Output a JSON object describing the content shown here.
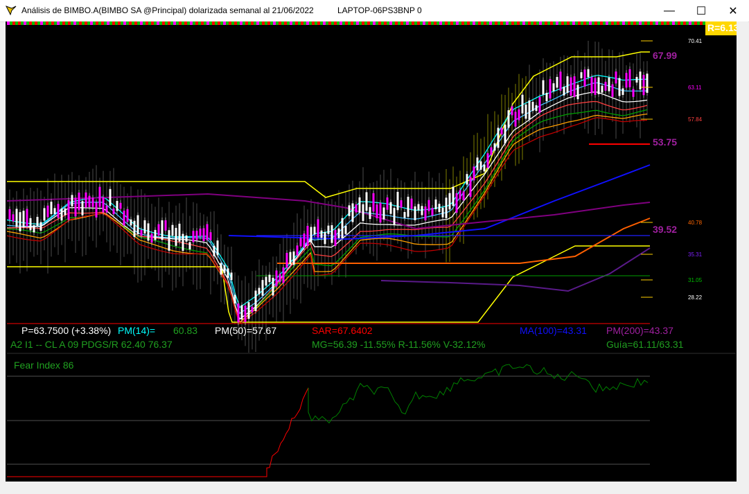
{
  "window": {
    "title": "Análisis de BIMBO.A(BIMBO SA @Principal) dolarizada semanal al 21/06/2022",
    "machine": "LAPTOP-06PS3BNP 0",
    "minimize_glyph": "—",
    "maximize_glyph": "☐",
    "close_glyph": "✕"
  },
  "colors": {
    "background": "#000000",
    "ichimoku": "#ffff00",
    "price_up": "#ffffff",
    "price_down": "#ff00ff",
    "sar": "#ff0000",
    "ma100": "#0000ff",
    "pm200": "#800080",
    "pm14": "#00ffff",
    "pm50": "#ffffff",
    "fear_green": "#008000",
    "fear_red": "#ff0000"
  },
  "r_badge": "R=6.13",
  "price_axis": {
    "top": "70.41",
    "l2": "63.11",
    "l3": "57.84",
    "l4": "40.78",
    "l5": "35.31",
    "l6": "31.05",
    "l7": "28.22",
    "big_top": "67.99",
    "big_mid": "53.75",
    "big_low": "39.52"
  },
  "info": {
    "p": "P=63.7500 (+3.38%)",
    "pm14_label": "PM(14)=",
    "pm14_value": "60.83",
    "pm50": "PM(50)=57.67",
    "sar": "SAR=67.6402",
    "ma100": "MA(100)=43.31",
    "pm200": "PM(200)=43.37",
    "line2_left": "A2 I1 -- CL A 09 PDGS/R 62.40 76.37",
    "line2_mid": "MG=56.39 -11.55% R-11.56% V-32.12%",
    "line2_right": "Guía=61.11/63.31"
  },
  "fear": {
    "label": "Fear Index 86"
  },
  "chart_data": {
    "type": "line",
    "title": "Análisis de BIMBO.A(BIMBO SA @Principal) dolarizada semanal al 21/06/2022",
    "y_ticks": [
      70.41,
      63.11,
      57.84,
      40.78,
      35.31,
      31.05,
      28.22
    ],
    "highlighted_levels": [
      67.99,
      53.75,
      39.52
    ],
    "series": [
      {
        "name": "PM(14)",
        "last": 60.83
      },
      {
        "name": "PM(50)",
        "last": 57.67
      },
      {
        "name": "SAR",
        "last": 67.6402
      },
      {
        "name": "MA(100)",
        "last": 43.31
      },
      {
        "name": "PM(200)",
        "last": 43.37
      }
    ],
    "last_price": 63.75,
    "last_change_pct": 3.38,
    "fear_index": 86
  }
}
